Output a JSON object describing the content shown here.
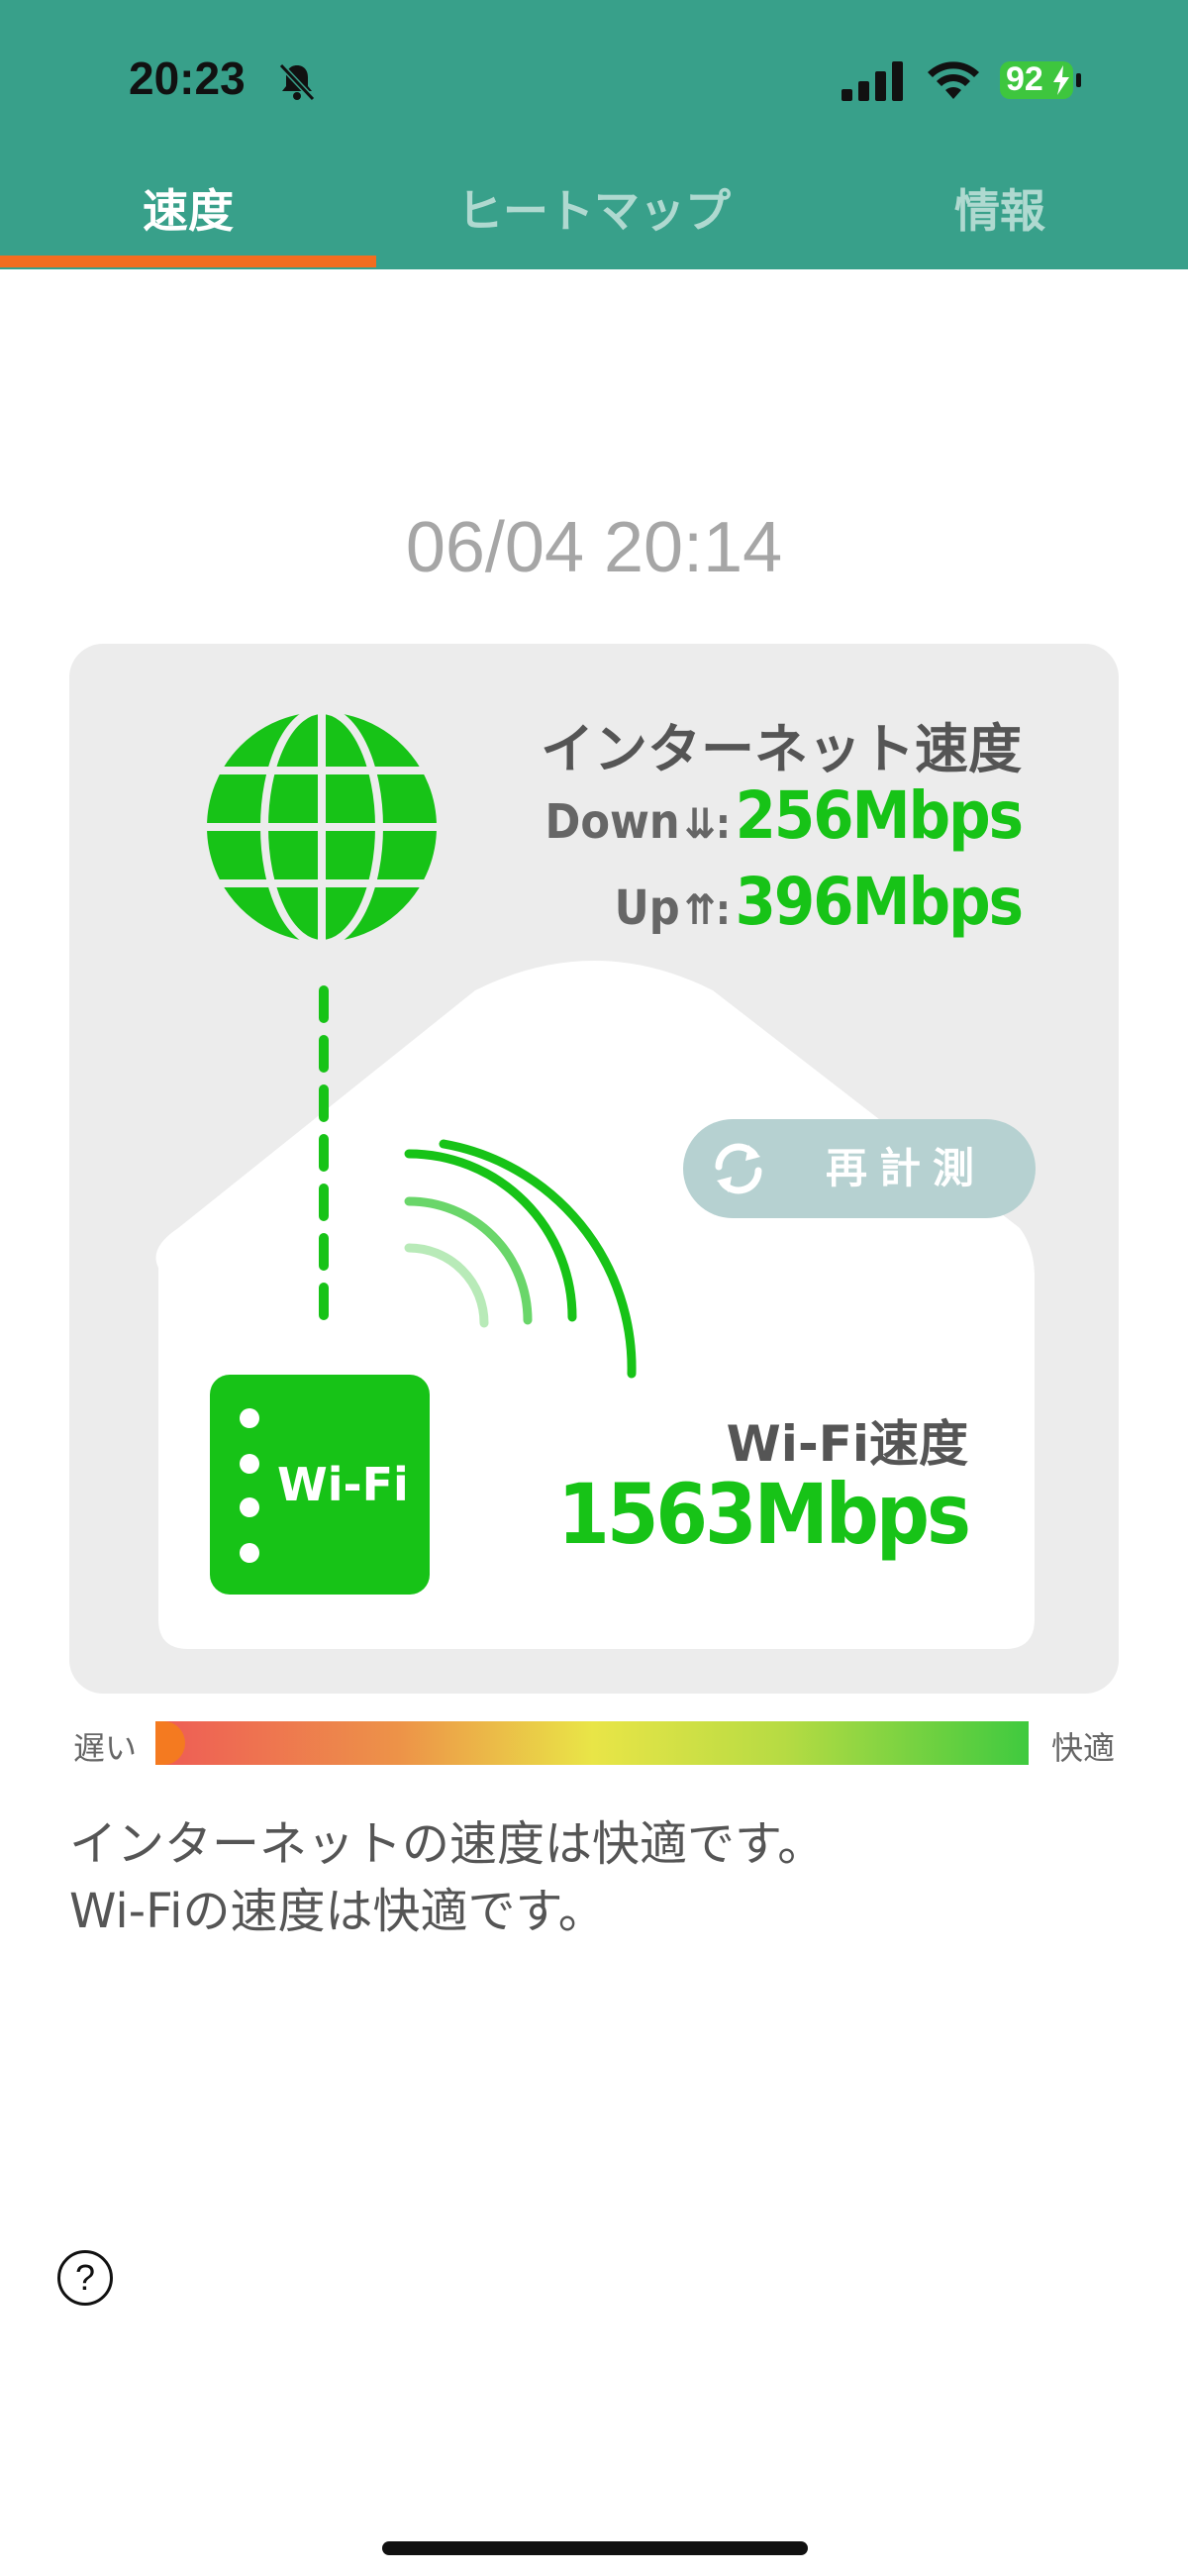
{
  "status_bar": {
    "time": "20:23",
    "battery": "92",
    "icons": [
      "bell-slash-icon",
      "signal-icon",
      "wifi-icon",
      "battery-charging-icon"
    ]
  },
  "tabs": [
    {
      "label": "速度",
      "active": true
    },
    {
      "label": "ヒートマップ",
      "active": false
    },
    {
      "label": "情報",
      "active": false
    }
  ],
  "main": {
    "timestamp": "06/04 20:14",
    "internet": {
      "title": "インターネット速度",
      "down_label": "Down",
      "down_arrow": "⇊:",
      "down_value": "256Mbps",
      "up_label": "Up",
      "up_arrow": "⇈:",
      "up_value": "396Mbps"
    },
    "remeasure_label": "再計測",
    "router_label": "Wi-Fi",
    "wifi": {
      "title": "Wi-Fi速度",
      "value": "1563Mbps"
    },
    "gauge": {
      "slow_label": "遅い",
      "fast_label": "快適"
    },
    "message_lines": [
      "インターネットの速度は快適です。",
      "Wi-Fiの速度は快適です。"
    ],
    "help_label": "?"
  },
  "colors": {
    "header": "#38a08a",
    "accent_tab": "#f36d1f",
    "speed_green": "#17c317",
    "remeasure_bg": "#b6d1d1"
  }
}
